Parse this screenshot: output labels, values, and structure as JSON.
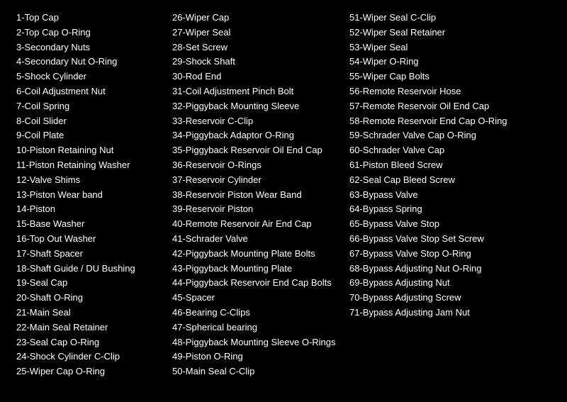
{
  "columns": [
    {
      "id": "col1",
      "items": [
        "1-Top Cap",
        "2-Top Cap O-Ring",
        "3-Secondary Nuts",
        "4-Secondary Nut O-Ring",
        "5-Shock Cylinder",
        "6-Coil Adjustment Nut",
        "7-Coil Spring",
        "8-Coil Slider",
        "9-Coil Plate",
        "10-Piston Retaining Nut",
        "11-Piston Retaining Washer",
        "12-Valve Shims",
        "13-Piston Wear band",
        "14-Piston",
        "15-Base Washer",
        "16-Top Out Washer",
        "17-Shaft Spacer",
        "18-Shaft Guide / DU Bushing",
        "19-Seal Cap",
        "20-Shaft O-Ring",
        "21-Main Seal",
        "22-Main Seal Retainer",
        "23-Seal Cap O-Ring",
        "24-Shock Cylinder C-Clip",
        "25-Wiper Cap O-Ring"
      ]
    },
    {
      "id": "col2",
      "items": [
        "26-Wiper Cap",
        "27-Wiper Seal",
        "28-Set Screw",
        "29-Shock Shaft",
        "30-Rod End",
        "31-Coil Adjustment Pinch Bolt",
        "32-Piggyback Mounting Sleeve",
        "33-Reservoir C-Clip",
        "34-Piggyback Adaptor O-Ring",
        "35-Piggyback Reservoir Oil End Cap",
        "36-Reservoir O-Rings",
        "37-Reservoir Cylinder",
        "38-Reservoir Piston Wear Band",
        "39-Reservoir Piston",
        "40-Remote Reservoir Air End Cap",
        "41-Schrader Valve",
        "42-Piggyback Mounting Plate Bolts",
        "43-Piggyback Mounting Plate",
        "44-Piggyback Reservoir End Cap Bolts",
        "45-Spacer",
        "46-Bearing C-Clips",
        "47-Spherical bearing",
        "48-Piggyback Mounting Sleeve O-Rings",
        "49-Piston O-Ring",
        "50-Main Seal C-Clip"
      ]
    },
    {
      "id": "col3",
      "items": [
        "51-Wiper Seal C-Clip",
        "52-Wiper Seal Retainer",
        "53-Wiper Seal",
        "54-Wiper O-Ring",
        "55-Wiper Cap Bolts",
        "56-Remote Reservoir Hose",
        "57-Remote Reservoir Oil End Cap",
        "58-Remote Reservoir End Cap O-Ring",
        "59-Schrader Valve Cap O-Ring",
        "60-Schrader Valve Cap",
        "61-Piston Bleed Screw",
        "62-Seal Cap Bleed Screw",
        "63-Bypass Valve",
        "64-Bypass Spring",
        "65-Bypass Valve Stop",
        "66-Bypass Valve Stop Set Screw",
        "67-Bypass Valve Stop O-Ring",
        "68-Bypass Adjusting Nut O-Ring",
        "69-Bypass Adjusting Nut",
        "70-Bypass Adjusting Screw",
        "71-Bypass Adjusting Jam Nut"
      ]
    }
  ]
}
